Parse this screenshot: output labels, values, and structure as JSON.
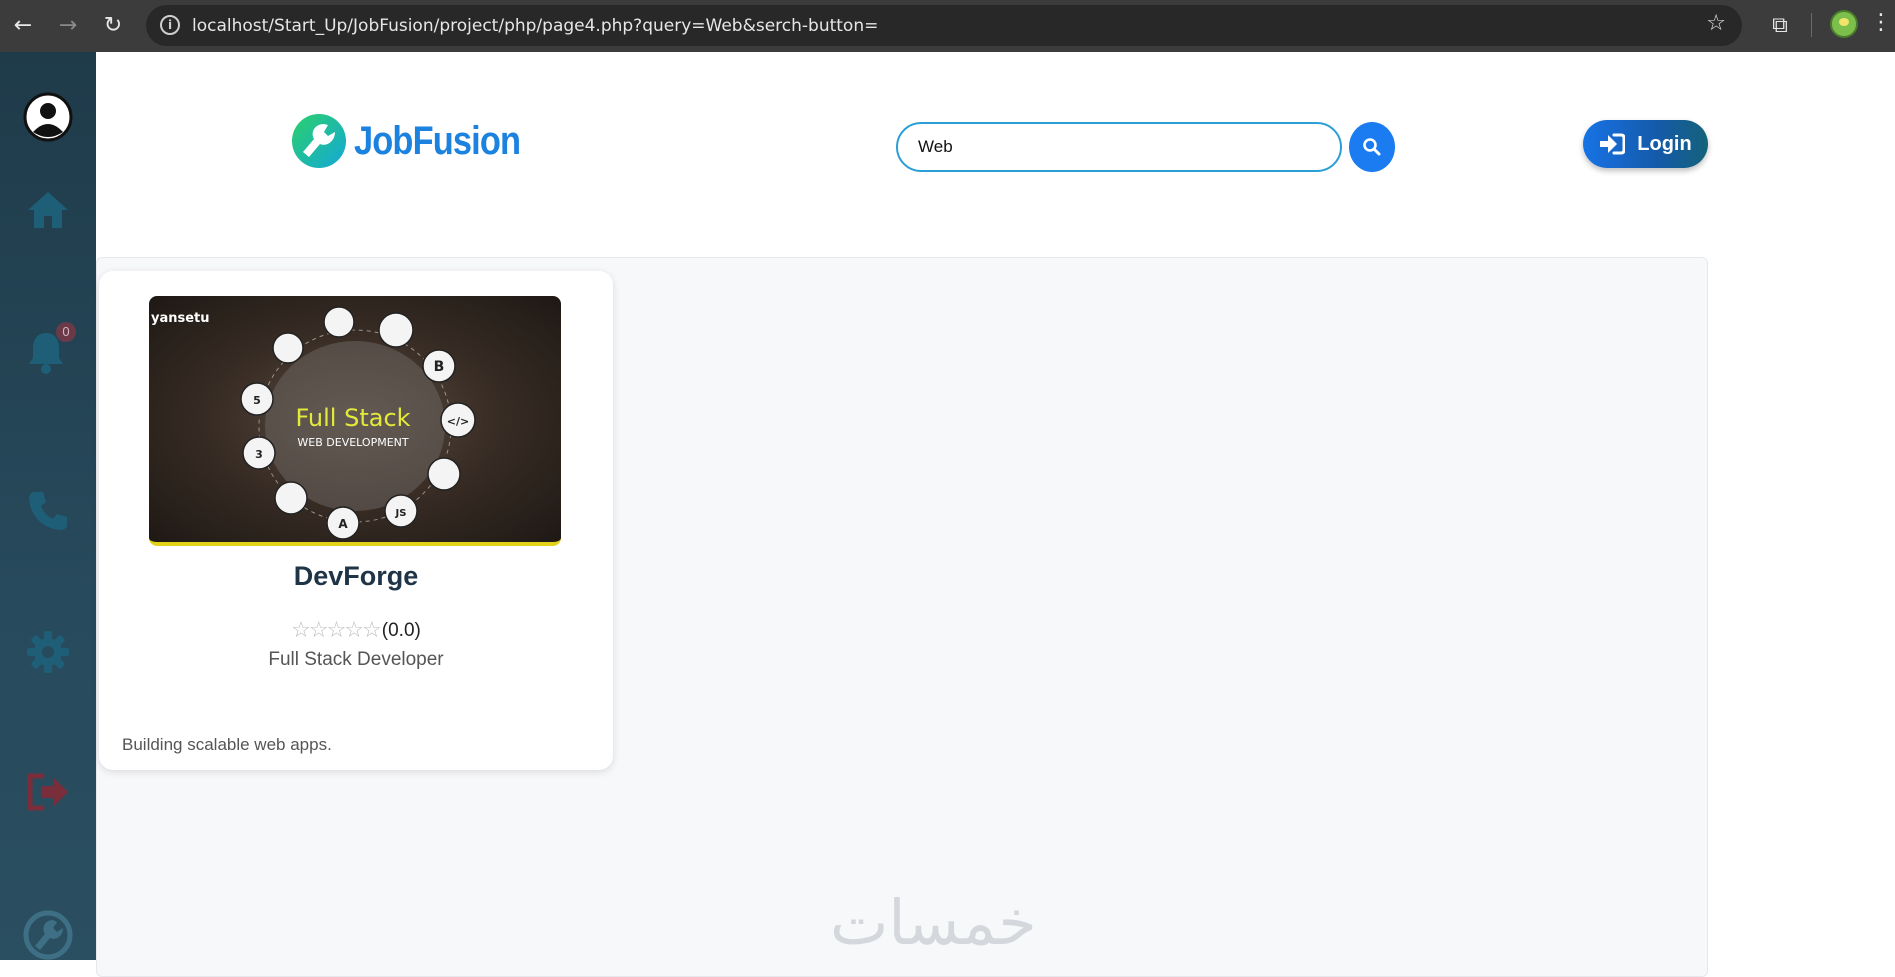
{
  "browser": {
    "url": "localhost/Start_Up/JobFusion/project/php/page4.php?query=Web&serch-button=",
    "back_icon": "←",
    "forward_icon": "→",
    "reload_icon": "↻",
    "star_icon": "☆",
    "extensions_icon": "⧉",
    "menu_icon": "⋮"
  },
  "sidebar": {
    "notification_count": "0",
    "items": [
      "profile",
      "home",
      "notifications",
      "contact",
      "settings",
      "logout",
      "logo"
    ]
  },
  "header": {
    "brand": "JobFusion",
    "search_value": "Web",
    "login_label": "Login"
  },
  "results": [
    {
      "title": "DevForge",
      "stars": "☆☆☆☆☆",
      "rating": "(0.0)",
      "role": "Full Stack Developer",
      "description": "Building scalable web apps.",
      "image": {
        "watermark": "yansetu",
        "headline": "Full Stack",
        "subline": "WEB DEVELOPMENT"
      }
    }
  ],
  "watermark": "خمسات",
  "colors": {
    "accent": "#1a7cf0",
    "sidebar": "#274a5c",
    "title": "#1f3447"
  }
}
